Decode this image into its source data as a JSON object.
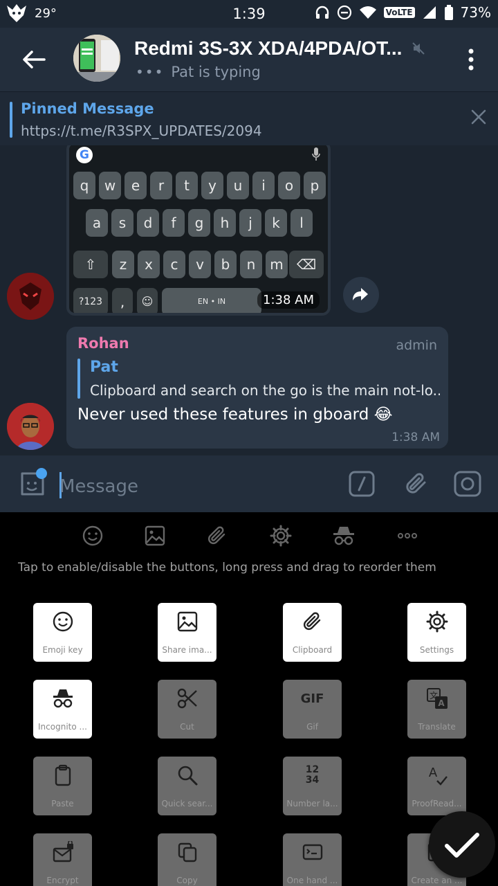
{
  "status_bar": {
    "temperature": "29°",
    "time": "1:39",
    "volte": "VoLTE",
    "battery": "73%"
  },
  "header": {
    "title": "Redmi 3S-3X XDA/4PDA/OT...",
    "typing": "Pat is typing"
  },
  "pinned": {
    "title": "Pinned Message",
    "text": "https://t.me/R3SPX_UPDATES/2094"
  },
  "keyboard_image": {
    "row1": [
      "q",
      "w",
      "e",
      "r",
      "t",
      "y",
      "u",
      "i",
      "o",
      "p"
    ],
    "row2": [
      "a",
      "s",
      "d",
      "f",
      "g",
      "h",
      "j",
      "k",
      "l"
    ],
    "row3": [
      "z",
      "x",
      "c",
      "v",
      "b",
      "n",
      "m"
    ],
    "sym_key": "?123",
    "comma_key": ",",
    "space_key": "EN • IN",
    "time": "1:38 AM"
  },
  "message": {
    "sender": "Rohan",
    "role": "admin",
    "reply_name": "Pat",
    "reply_text": "Clipboard and search on the go is the main not-lo...",
    "text": "Never used these features in gboard 😂",
    "time": "1:38 AM"
  },
  "input": {
    "placeholder": "Message"
  },
  "hint": "Tap to enable/disable the buttons, long press and drag to reorder them",
  "tiles": [
    {
      "label": "Emoji key",
      "icon": "emoji-icon",
      "enabled": true
    },
    {
      "label": "Share ima...",
      "icon": "image-icon",
      "enabled": true
    },
    {
      "label": "Clipboard",
      "icon": "clipboard-icon",
      "enabled": true
    },
    {
      "label": "Settings",
      "icon": "gear-icon",
      "enabled": true
    },
    {
      "label": "Incognito ...",
      "icon": "incognito-icon",
      "enabled": true
    },
    {
      "label": "Cut",
      "icon": "scissors-icon",
      "enabled": false
    },
    {
      "label": "Gif",
      "icon": "gif-icon",
      "enabled": false,
      "glyph": "GIF"
    },
    {
      "label": "Translate",
      "icon": "translate-icon",
      "enabled": false
    },
    {
      "label": "Paste",
      "icon": "paste-icon",
      "enabled": false
    },
    {
      "label": "Quick sear...",
      "icon": "search-icon",
      "enabled": false
    },
    {
      "label": "Number la...",
      "icon": "number-layout-icon",
      "enabled": false,
      "glyph": "12\n34"
    },
    {
      "label": "ProofRead...",
      "icon": "proofread-icon",
      "enabled": false
    },
    {
      "label": "Encrypt",
      "icon": "encrypt-icon",
      "enabled": false
    },
    {
      "label": "Copy",
      "icon": "copy-icon",
      "enabled": false
    },
    {
      "label": "One hand ...",
      "icon": "one-hand-icon",
      "enabled": false
    },
    {
      "label": "Create an ...",
      "icon": "create-icon",
      "enabled": false
    }
  ],
  "colors": {
    "header_bg": "#232e3c",
    "chat_bg": "#1c2530",
    "accent": "#5ea6ea",
    "sender_name": "#ee7aae"
  }
}
